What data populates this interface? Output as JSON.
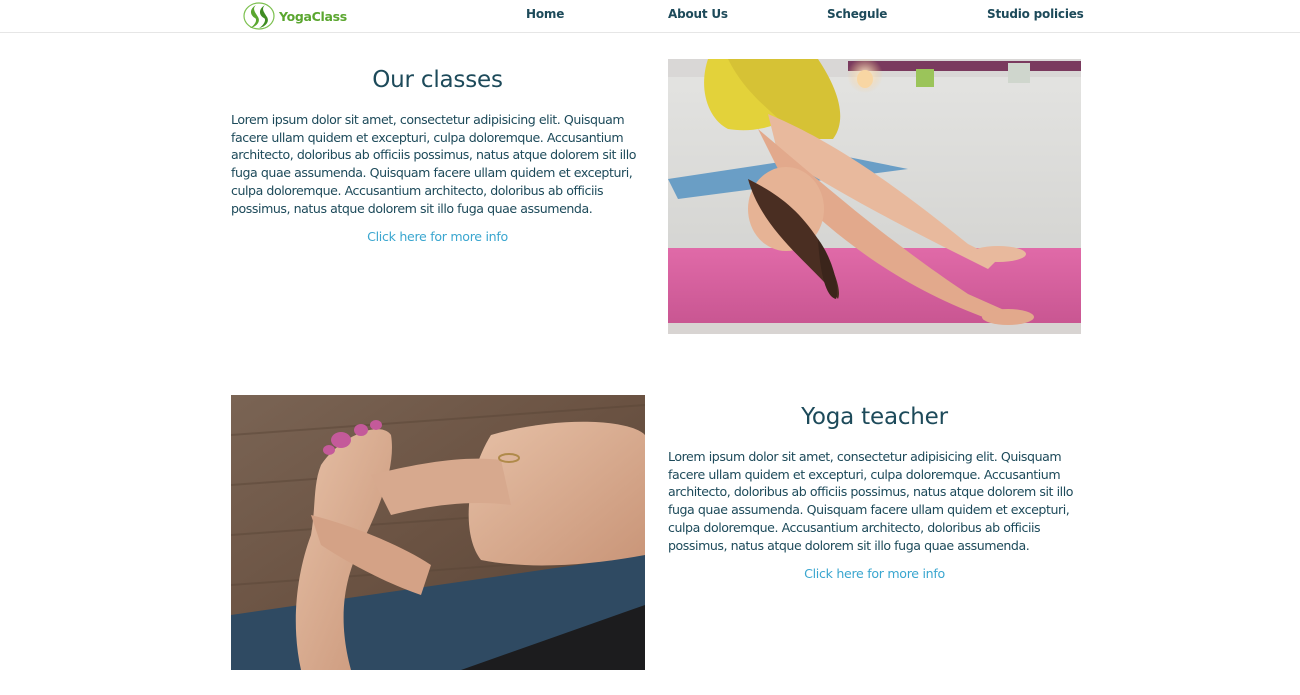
{
  "brand": {
    "name": "YogaClass",
    "logo_icon": "yoga-leaf-logo-icon",
    "color": "#5aa62f"
  },
  "nav": {
    "items": [
      {
        "label": "Home"
      },
      {
        "label": "About Us"
      },
      {
        "label": "Schegule"
      },
      {
        "label": "Studio policies"
      }
    ]
  },
  "sections": [
    {
      "title": "Our classes",
      "body": "Lorem ipsum dolor sit amet, consectetur adipisicing elit. Quisquam facere ullam quidem et excepturi, culpa doloremque. Accusantium architecto, doloribus ab officiis possimus, natus atque dolorem sit illo fuga quae assumenda. Quisquam facere ullam quidem et excepturi, culpa doloremque. Accusantium architecto, doloribus ab officiis possimus, natus atque dolorem sit illo fuga quae assumenda.",
      "link": "Click here for more info",
      "image": "woman-downward-dog-pose-photo"
    },
    {
      "title": "Yoga teacher",
      "body": "Lorem ipsum dolor sit amet, consectetur adipisicing elit. Quisquam facere ullam quidem et excepturi, culpa doloremque. Accusantium architecto, doloribus ab officiis possimus, natus atque dolorem sit illo fuga quae assumenda. Quisquam facere ullam quidem et excepturi, culpa doloremque. Accusantium architecto, doloribus ab officiis possimus, natus atque dolorem sit illo fuga quae assumenda.",
      "link": "Click here for more info",
      "image": "hands-holding-foot-stretch-photo"
    }
  ],
  "colors": {
    "text": "#1d4a5a",
    "link": "#3aa6cf",
    "divider": "#e6e6e6"
  }
}
